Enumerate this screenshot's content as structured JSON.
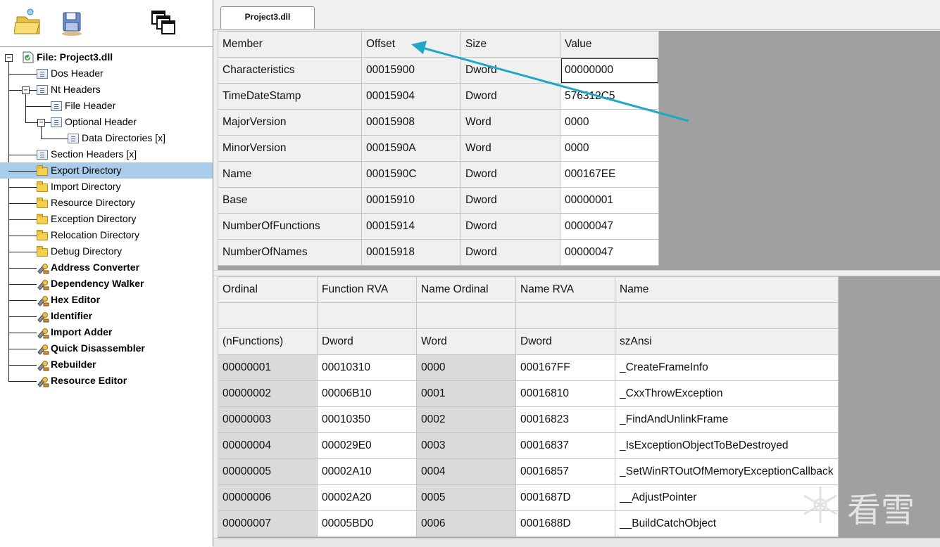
{
  "tab": {
    "label": "Project3.dll"
  },
  "tree": {
    "root_label": "File: Project3.dll",
    "items": [
      {
        "label": "Dos Header",
        "icon": "doc"
      },
      {
        "label": "Nt Headers",
        "icon": "doc"
      },
      {
        "label": "File Header",
        "icon": "doc"
      },
      {
        "label": "Optional Header",
        "icon": "doc"
      },
      {
        "label": "Data Directories [x]",
        "icon": "doc"
      },
      {
        "label": "Section Headers [x]",
        "icon": "doc"
      },
      {
        "label": "Export Directory",
        "icon": "folder"
      },
      {
        "label": "Import Directory",
        "icon": "folder"
      },
      {
        "label": "Resource Directory",
        "icon": "folder"
      },
      {
        "label": "Exception Directory",
        "icon": "folder"
      },
      {
        "label": "Relocation Directory",
        "icon": "folder"
      },
      {
        "label": "Debug Directory",
        "icon": "folder"
      },
      {
        "label": "Address Converter",
        "icon": "tool"
      },
      {
        "label": "Dependency Walker",
        "icon": "tool"
      },
      {
        "label": "Hex Editor",
        "icon": "tool"
      },
      {
        "label": "Identifier",
        "icon": "tool"
      },
      {
        "label": "Import Adder",
        "icon": "tool"
      },
      {
        "label": "Quick Disassembler",
        "icon": "tool"
      },
      {
        "label": "Rebuilder",
        "icon": "tool"
      },
      {
        "label": "Resource Editor",
        "icon": "tool"
      }
    ],
    "selected": "Export Directory"
  },
  "export_header": {
    "columns": [
      "Member",
      "Offset",
      "Size",
      "Value"
    ],
    "rows": [
      [
        "Characteristics",
        "00015900",
        "Dword",
        "00000000"
      ],
      [
        "TimeDateStamp",
        "00015904",
        "Dword",
        "576312C5"
      ],
      [
        "MajorVersion",
        "00015908",
        "Word",
        "0000"
      ],
      [
        "MinorVersion",
        "0001590A",
        "Word",
        "0000"
      ],
      [
        "Name",
        "0001590C",
        "Dword",
        "000167EE"
      ],
      [
        "Base",
        "00015910",
        "Dword",
        "00000001"
      ],
      [
        "NumberOfFunctions",
        "00015914",
        "Dword",
        "00000047"
      ],
      [
        "NumberOfNames",
        "00015918",
        "Dword",
        "00000047"
      ]
    ]
  },
  "functions": {
    "columns": [
      "Ordinal",
      "Function RVA",
      "Name Ordinal",
      "Name RVA",
      "Name"
    ],
    "subheader_blank": [
      "",
      "",
      "",
      "",
      ""
    ],
    "subheader_types": [
      "(nFunctions)",
      "Dword",
      "Word",
      "Dword",
      "szAnsi"
    ],
    "rows": [
      [
        "00000001",
        "00010310",
        "0000",
        "000167FF",
        "_CreateFrameInfo"
      ],
      [
        "00000002",
        "00006B10",
        "0001",
        "00016810",
        "_CxxThrowException"
      ],
      [
        "00000003",
        "00010350",
        "0002",
        "00016823",
        "_FindAndUnlinkFrame"
      ],
      [
        "00000004",
        "000029E0",
        "0003",
        "00016837",
        "_IsExceptionObjectToBeDestroyed"
      ],
      [
        "00000005",
        "00002A10",
        "0004",
        "00016857",
        "_SetWinRTOutOfMemoryExceptionCallback"
      ],
      [
        "00000006",
        "00002A20",
        "0005",
        "0001687D",
        "__AdjustPointer"
      ],
      [
        "00000007",
        "00005BD0",
        "0006",
        "0001688D",
        "__BuildCatchObject"
      ]
    ]
  },
  "watermark": {
    "text": "看雪"
  },
  "colors": {
    "selection": "#a8ccea",
    "arrow": "#1ea7c6",
    "grid_bg": "#a0a0a0"
  }
}
